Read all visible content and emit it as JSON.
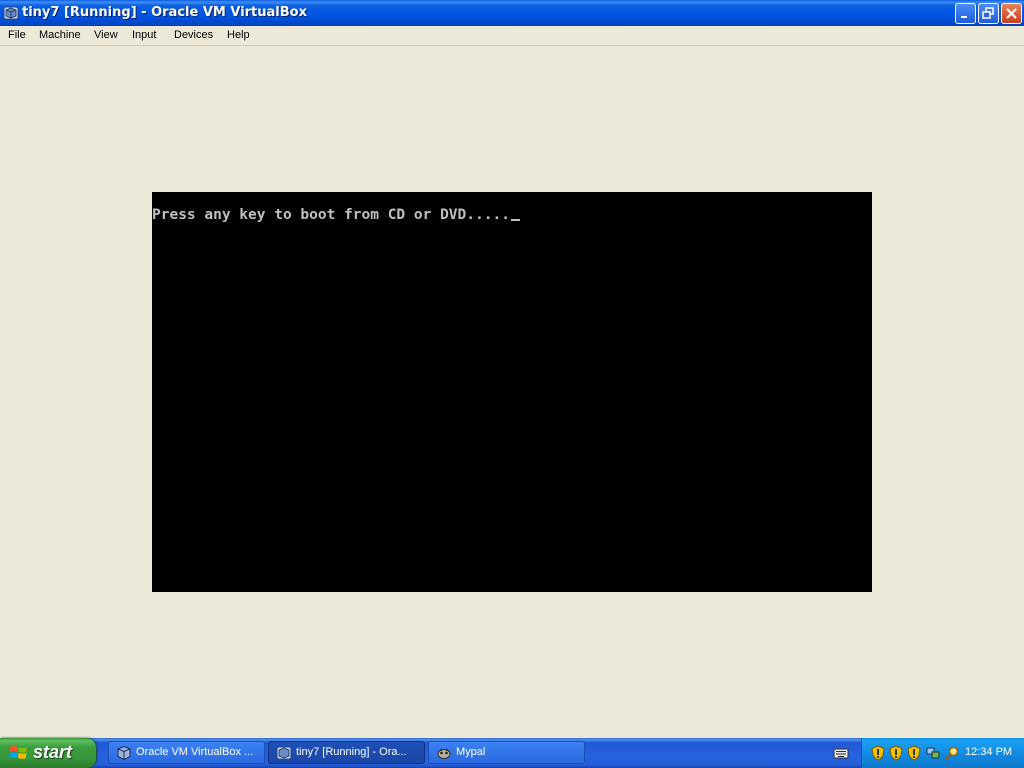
{
  "window": {
    "title": "tiny7 [Running] - Oracle VM VirtualBox"
  },
  "menu": {
    "items": [
      "File",
      "Machine",
      "View",
      "Input",
      "Devices",
      "Help"
    ]
  },
  "vm": {
    "boot_message": "Press any key to boot from CD or DVD....."
  },
  "taskbar": {
    "start_label": "start",
    "buttons": [
      {
        "label": "Oracle VM VirtualBox ...",
        "icon": "virtualbox-icon",
        "active": false
      },
      {
        "label": "tiny7 [Running] - Ora...",
        "icon": "vm-window-icon",
        "active": true
      },
      {
        "label": "Mypal",
        "icon": "mypal-icon",
        "active": false
      }
    ],
    "clock": "12:34 PM"
  },
  "colors": {
    "titlebar": "#0054e3",
    "workspace": "#ece9d8",
    "vm_screen": "#000000",
    "boot_text": "#c0c0c0",
    "start_button": "#3b9d3b",
    "tray": "#1187e0"
  }
}
